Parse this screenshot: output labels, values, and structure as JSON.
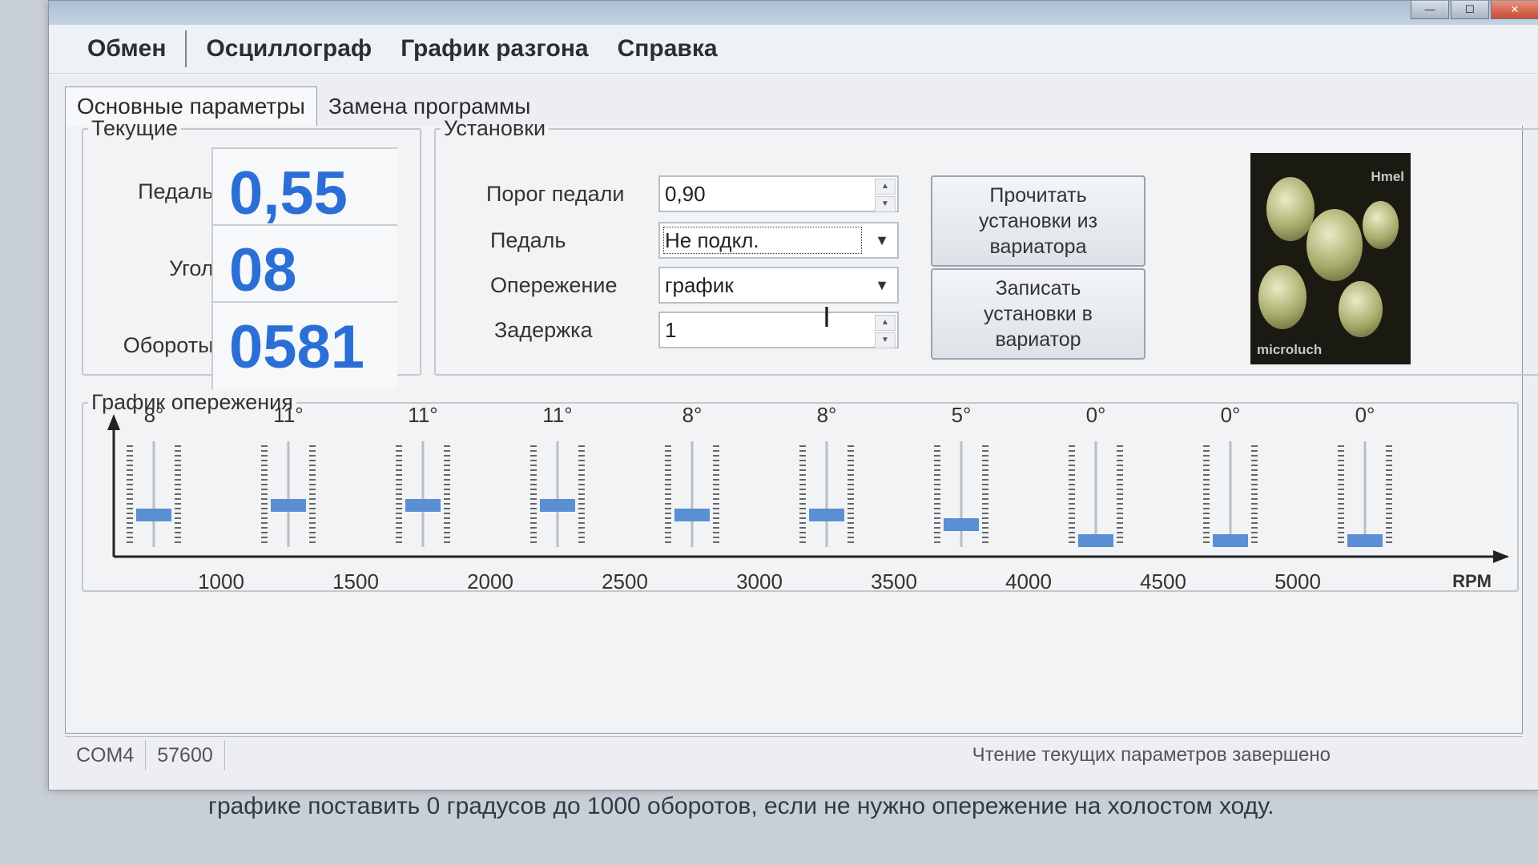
{
  "menu": {
    "items": [
      "Обмен",
      "Осциллограф",
      "График разгона",
      "Справка"
    ]
  },
  "tabs": [
    "Основные параметры",
    "Замена программы"
  ],
  "current": {
    "legend": "Текущие",
    "pedal_label": "Педаль:",
    "pedal_value": "0,55",
    "angle_label": "Угол:",
    "angle_value": "08",
    "rpm_label": "Обороты:",
    "rpm_value": "0581"
  },
  "settings": {
    "legend": "Установки",
    "pedal_threshold_label": "Порог педали",
    "pedal_threshold_value": "0,90",
    "pedal_label": "Педаль",
    "pedal_value": "Не подкл.",
    "advance_label": "Опережение",
    "advance_value": "график",
    "delay_label": "Задержка",
    "delay_value": "1",
    "read_button": "Прочитать установки из вариатора",
    "write_button": "Записать установки в вариатор"
  },
  "image": {
    "text_top": "Hmel",
    "text_bottom": "microluch"
  },
  "chart_data": {
    "type": "bar",
    "title": "График опережения",
    "xlabel": "RPM",
    "categories": [
      "1000",
      "1500",
      "2000",
      "2500",
      "3000",
      "3500",
      "4000",
      "4500",
      "5000"
    ],
    "x_ticks": [
      "1000",
      "1500",
      "2000",
      "2500",
      "3000",
      "3500",
      "4000",
      "4500",
      "5000"
    ],
    "slider_labels": [
      "8°",
      "11°",
      "11°",
      "11°",
      "8°",
      "8°",
      "5°",
      "0°",
      "0°",
      "0°"
    ],
    "values": [
      8,
      11,
      11,
      11,
      8,
      8,
      5,
      0,
      0,
      0
    ],
    "ylim": [
      0,
      30
    ],
    "slider_color": "#5b8fd4"
  },
  "status": {
    "port": "COM4",
    "baud": "57600",
    "message": "Чтение текущих параметров завершено"
  },
  "caption": "графике поставить 0 градусов до 1000 оборотов, если не нужно опережение на холостом ходу."
}
